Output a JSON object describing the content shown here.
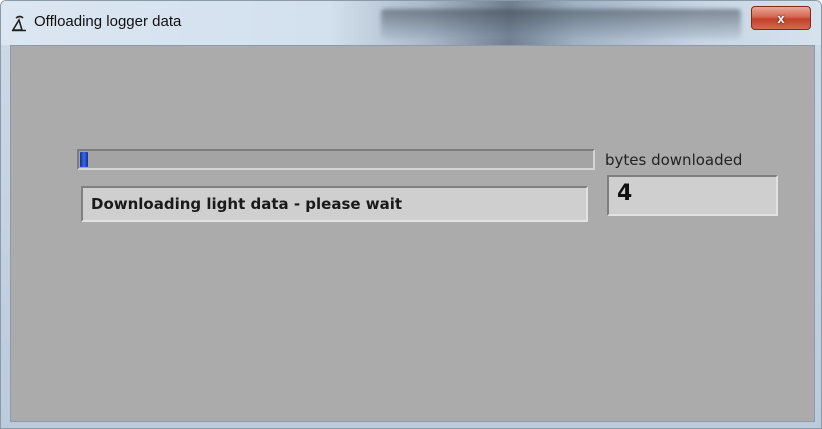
{
  "window": {
    "title": "Offloading logger data",
    "app_icon": "logger-app-icon",
    "close_icon": "close-icon",
    "close_glyph": "x"
  },
  "progress": {
    "fraction": 0.015,
    "fill_color": "#1a44c8"
  },
  "status": {
    "text": "Downloading light data - please wait"
  },
  "bytes": {
    "label": "bytes downloaded",
    "value": "4"
  }
}
